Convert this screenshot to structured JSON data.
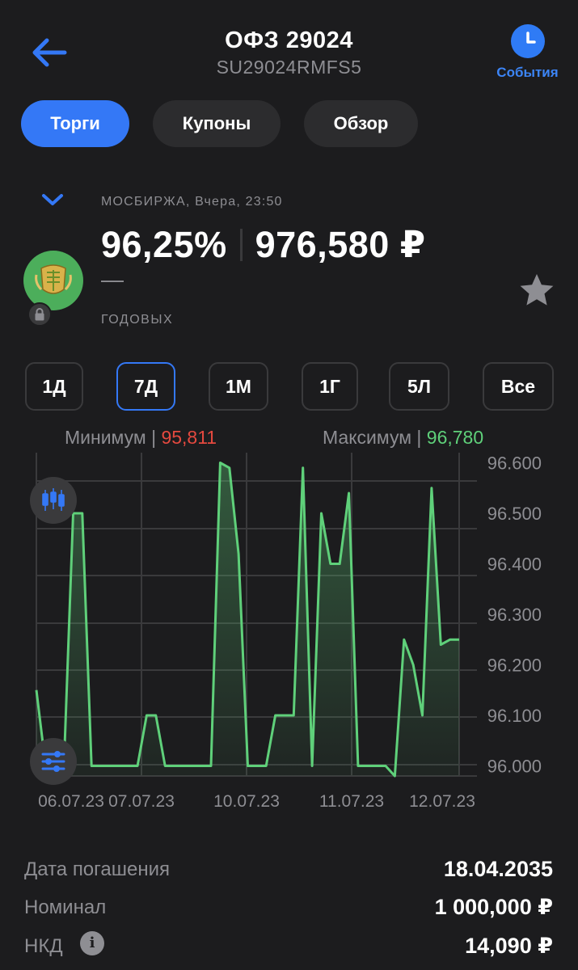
{
  "header": {
    "title": "ОФЗ 29024",
    "subtitle": "SU29024RMFS5",
    "events_label": "События"
  },
  "tabs": [
    {
      "label": "Торги",
      "active": true
    },
    {
      "label": "Купоны",
      "active": false
    },
    {
      "label": "Обзор",
      "active": false
    }
  ],
  "quote": {
    "exchange_time": "МОСБИРЖА, Вчера, 23:50",
    "price_percent": "96,25%",
    "price_rub": "976,580 ₽",
    "yield_dash": "—",
    "yield_label": "ГОДОВЫХ"
  },
  "periods": [
    {
      "label": "1Д",
      "active": false
    },
    {
      "label": "7Д",
      "active": true
    },
    {
      "label": "1М",
      "active": false
    },
    {
      "label": "1Г",
      "active": false
    },
    {
      "label": "5Л",
      "active": false
    },
    {
      "label": "Все",
      "active": false
    }
  ],
  "minmax": {
    "min_label": "Минимум",
    "min_value": "95,811",
    "max_label": "Максимум",
    "max_value": "96,780"
  },
  "chart_data": {
    "type": "area",
    "x_tick_labels": [
      "06.07.23",
      "07.07.23",
      "10.07.23",
      "11.07.23",
      "12.07.23"
    ],
    "y_tick_labels": [
      "96.600",
      "96.500",
      "96.400",
      "96.300",
      "96.200",
      "96.100",
      "96.000"
    ],
    "ylim": [
      95.98,
      96.62
    ],
    "grid": true,
    "line_color": "#5fd07a",
    "series": [
      {
        "values": [
          96.15,
          96.0,
          96.0,
          96.0,
          96.5,
          96.5,
          96.0,
          96.0,
          96.0,
          96.0,
          96.0,
          96.0,
          96.1,
          96.1,
          96.0,
          96.0,
          96.0,
          96.0,
          96.0,
          96.0,
          96.6,
          96.59,
          96.42,
          96.0,
          96.0,
          96.0,
          96.1,
          96.1,
          96.1,
          96.59,
          96.0,
          96.5,
          96.4,
          96.4,
          96.54,
          96.0,
          96.0,
          96.0,
          96.0,
          95.98,
          96.25,
          96.2,
          96.1,
          96.55,
          96.24,
          96.25,
          96.25
        ]
      }
    ]
  },
  "details": [
    {
      "label": "Дата погашения",
      "value": "18.04.2035"
    },
    {
      "label": "Номинал",
      "value": "1 000,000 ₽"
    },
    {
      "label": "НКД",
      "value": "14,090 ₽"
    }
  ],
  "icons": {
    "back": "arrow-left-icon",
    "events": "clock-icon",
    "chevron": "chevron-down-icon",
    "lock": "lock-icon",
    "star": "star-icon",
    "candles": "candlestick-icon",
    "settings": "sliders-icon",
    "info": "info-icon"
  },
  "colors": {
    "accent": "#3478f6",
    "background": "#1c1c1e",
    "min_red": "#e5493f",
    "max_green": "#5fd07a"
  }
}
